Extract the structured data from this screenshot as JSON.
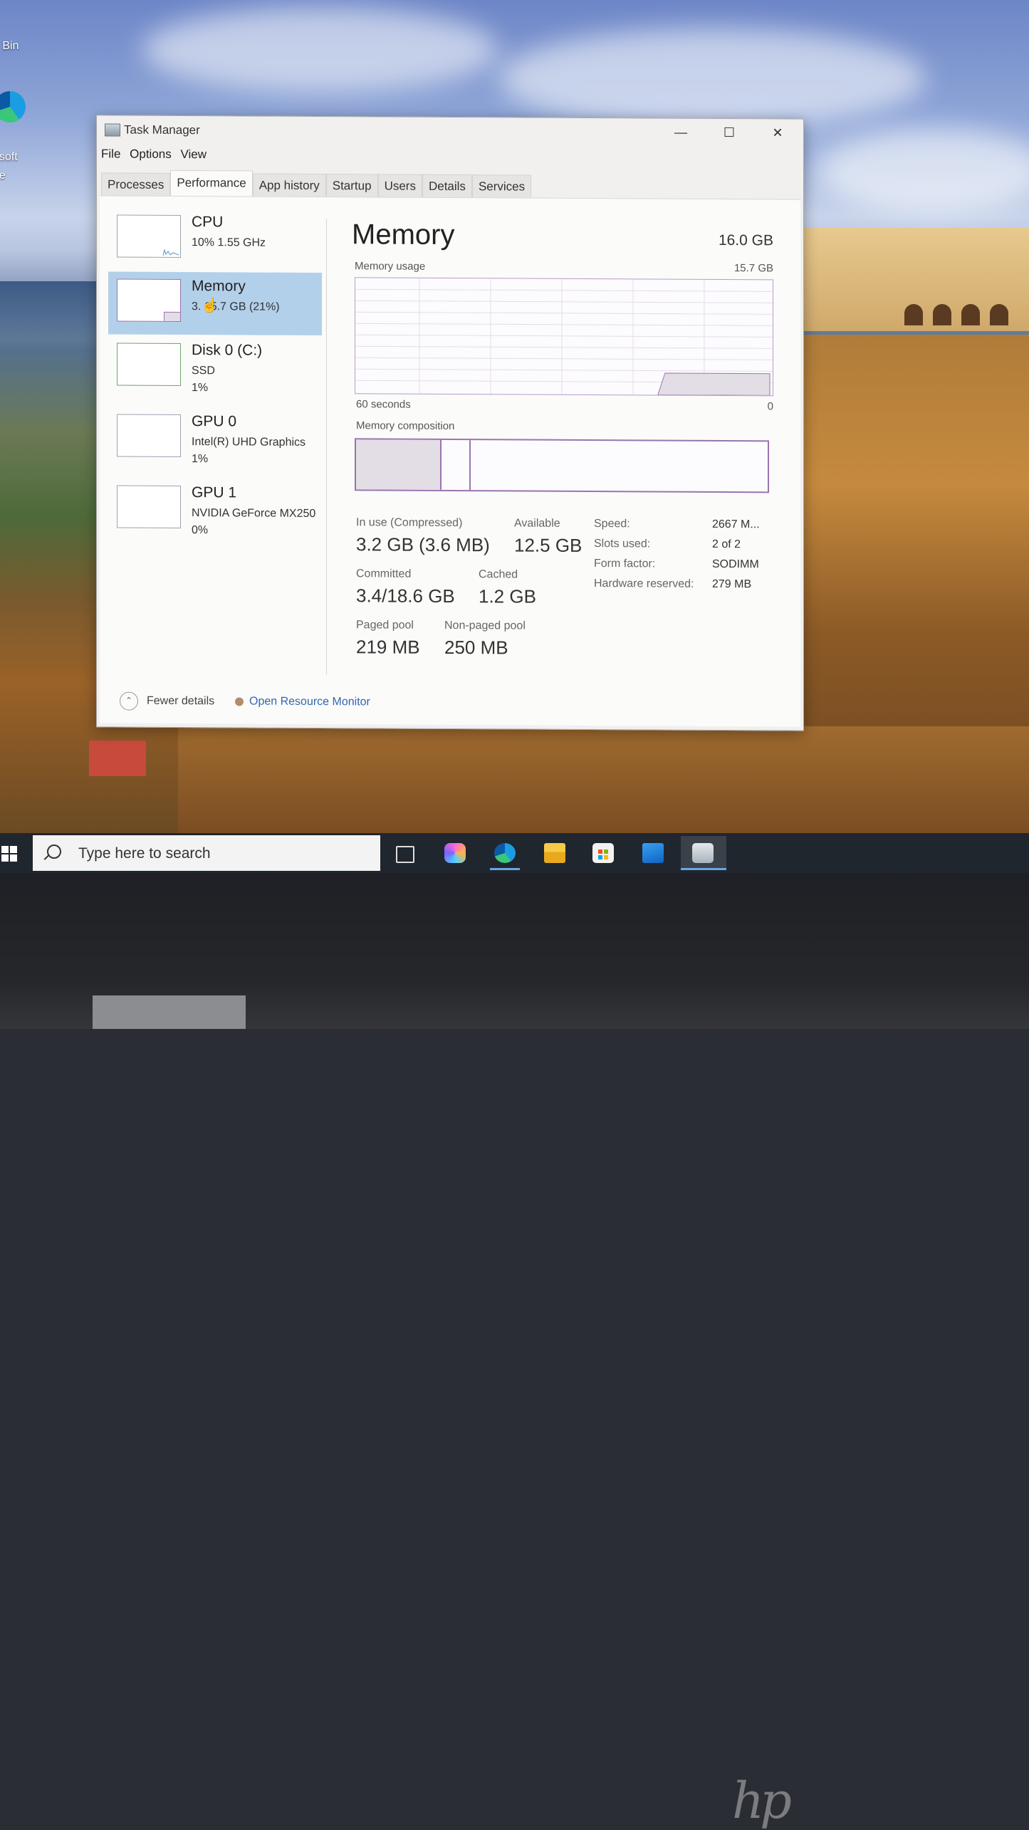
{
  "desktop": {
    "icons": [
      {
        "label": "e Bin",
        "icon": "recycle-bin-icon"
      },
      {
        "label": "osoft\nge",
        "icon": "edge-icon"
      }
    ]
  },
  "window": {
    "title": "Task Manager",
    "controls": {
      "minimize": "—",
      "maximize": "☐",
      "close": "✕"
    },
    "menu": [
      "File",
      "Options",
      "View"
    ],
    "tabs": [
      "Processes",
      "Performance",
      "App history",
      "Startup",
      "Users",
      "Details",
      "Services"
    ],
    "active_tab": "Performance"
  },
  "resources": [
    {
      "name": "CPU",
      "sub1": "10%  1.55 GHz",
      "sub2": ""
    },
    {
      "name": "Memory",
      "sub1": "3.  15.7 GB (21%)",
      "sub2": ""
    },
    {
      "name": "Disk 0 (C:)",
      "sub1": "SSD",
      "sub2": "1%"
    },
    {
      "name": "GPU 0",
      "sub1": "Intel(R) UHD Graphics",
      "sub2": "1%"
    },
    {
      "name": "GPU 1",
      "sub1": "NVIDIA GeForce MX250",
      "sub2": "0%"
    }
  ],
  "memory": {
    "title": "Memory",
    "total": "16.0 GB",
    "usage_label": "Memory usage",
    "usage_max": "15.7 GB",
    "axis_left": "60 seconds",
    "axis_right": "0",
    "composition_label": "Memory composition",
    "stats": {
      "in_use_label": "In use (Compressed)",
      "in_use_value": "3.2 GB (3.6 MB)",
      "available_label": "Available",
      "available_value": "12.5 GB",
      "committed_label": "Committed",
      "committed_value": "3.4/18.6 GB",
      "cached_label": "Cached",
      "cached_value": "1.2 GB",
      "paged_label": "Paged pool",
      "paged_value": "219 MB",
      "nonpaged_label": "Non-paged pool",
      "nonpaged_value": "250 MB"
    },
    "specs": [
      {
        "key": "Speed:",
        "value": "2667 M..."
      },
      {
        "key": "Slots used:",
        "value": "2 of 2"
      },
      {
        "key": "Form factor:",
        "value": "SODIMM"
      },
      {
        "key": "Hardware reserved:",
        "value": "279 MB"
      }
    ],
    "usage_fraction": 0.21
  },
  "footer": {
    "fewer_details": "Fewer details",
    "open_resource_monitor": "Open Resource Monitor"
  },
  "taskbar": {
    "search_placeholder": "Type here to search",
    "apps": [
      "task-view-icon",
      "copilot-icon",
      "edge-icon",
      "file-explorer-icon",
      "microsoft-store-icon",
      "mail-icon",
      "task-manager-icon"
    ]
  },
  "laptop": {
    "logo": "hp"
  },
  "colors": {
    "selected": "#b3d0ea",
    "memory_accent": "#9a74b0",
    "link": "#3466b0",
    "taskbar": "#20262e"
  }
}
